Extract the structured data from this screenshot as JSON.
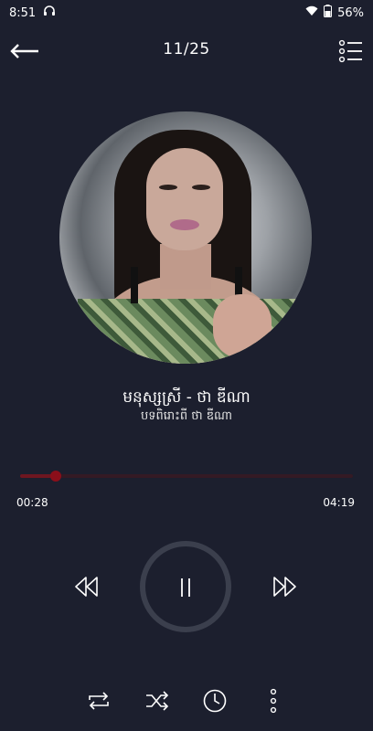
{
  "status_bar": {
    "time": "8:51",
    "battery": "56%"
  },
  "top_bar": {
    "track_counter": "11/25"
  },
  "song": {
    "title": "មនុស្សស្រី  - ថា ឌីណា",
    "artist": "បទពិរោះពី ថា ឌីណា"
  },
  "progress": {
    "elapsed": "00:28",
    "total": "04:19",
    "fraction": 0.108
  },
  "icons": {
    "back": "back-arrow-icon",
    "queue": "playlist-icon",
    "prev": "previous-icon",
    "pause": "pause-icon",
    "next": "next-icon",
    "repeat": "repeat-icon",
    "shuffle": "shuffle-icon",
    "timer": "clock-icon",
    "more": "more-vertical-icon"
  },
  "colors": {
    "background": "#1c1f2e",
    "progress_played": "#6e1620",
    "progress_thumb": "#8b0f1a",
    "play_ring": "#3b3f4d"
  }
}
